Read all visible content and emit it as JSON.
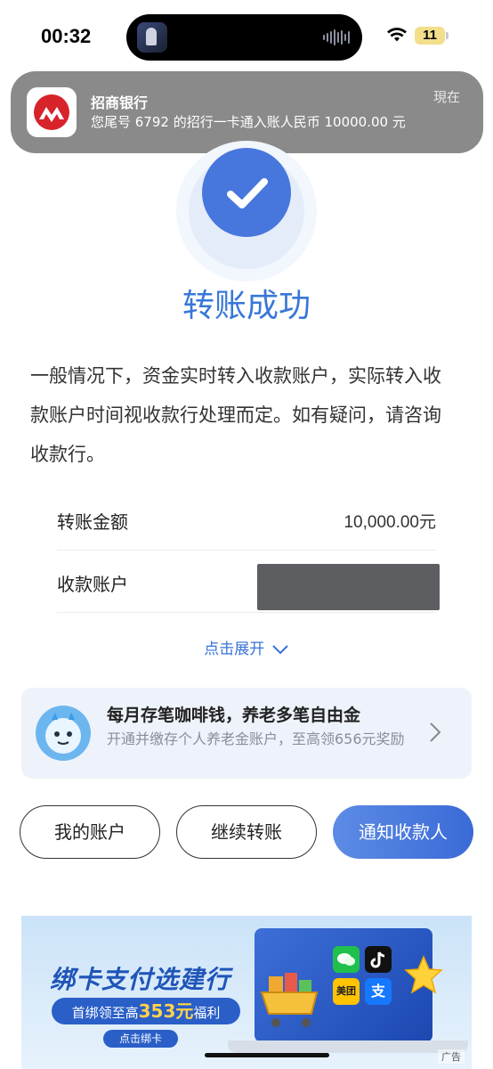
{
  "status_bar": {
    "time": "00:32",
    "battery": "11"
  },
  "notification": {
    "app_name": "招商银行",
    "message": "您尾号 6792 的招行一卡通入账人民币 10000.00 元",
    "time": "現在"
  },
  "result": {
    "title": "转账成功",
    "description": "一般情况下，资金实时转入收款账户，实际转入收款账户时间视收款行处理而定。如有疑问，请咨询收款行。"
  },
  "details": [
    {
      "label": "转账金额",
      "value": "10,000.00元"
    },
    {
      "label": "收款账户",
      "value": ""
    }
  ],
  "expand_label": "点击展开",
  "promo": {
    "title": "每月存笔咖啡钱，养老多笔自由金",
    "subtitle": "开通并缴存个人养老金账户，至高领656元奖励"
  },
  "buttons": {
    "my_account": "我的账户",
    "continue_transfer": "继续转账",
    "notify_payee": "通知收款人"
  },
  "banner": {
    "title": "绑卡支付选建行",
    "pill_prefix": "首绑领至高",
    "pill_amount": "353元",
    "pill_suffix": "福利",
    "button": "点击绑卡",
    "app_tiles": [
      "美团",
      "支"
    ],
    "ad_tag": "广告"
  },
  "colors": {
    "accent": "#3877d8",
    "success_circle": "#4777dd",
    "notification_bg": "#7d7d7d",
    "promo_bg": "#eef3fb"
  }
}
